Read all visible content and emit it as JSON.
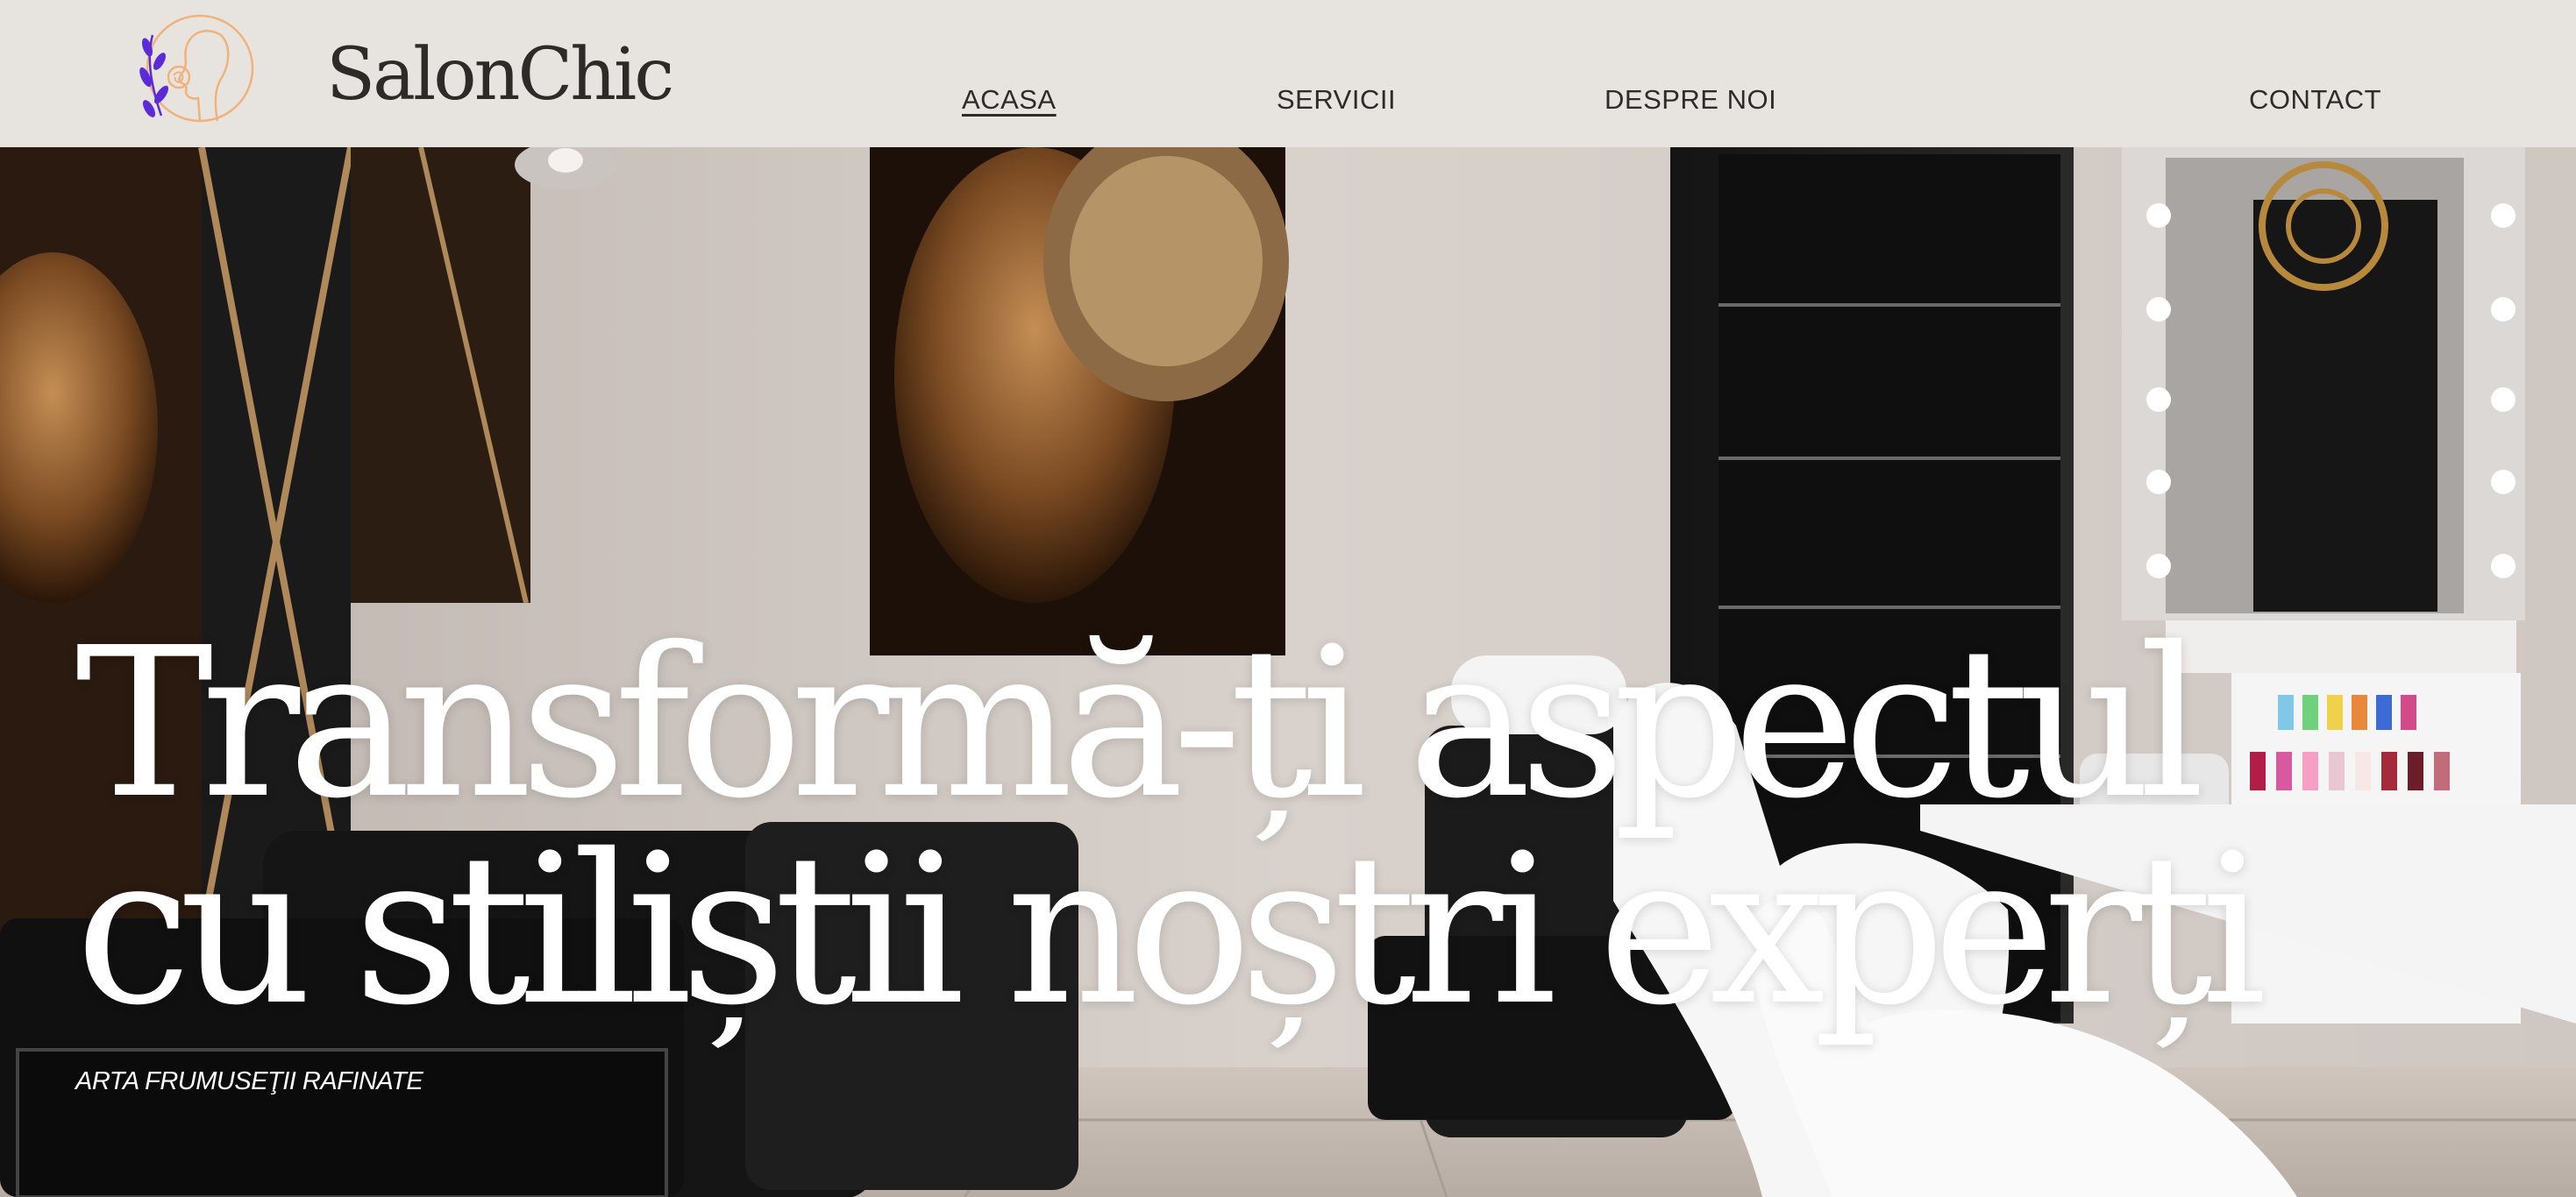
{
  "brand": {
    "name": "SalonChic",
    "logo_icon": "woman-profile-rose-logo"
  },
  "nav": {
    "items": [
      {
        "label": "ACASA",
        "active": true
      },
      {
        "label": "SERVICII",
        "active": false
      },
      {
        "label": "DESPRE NOI",
        "active": false
      },
      {
        "label": "CONTACT",
        "active": false
      }
    ]
  },
  "hero": {
    "headline_line1": "Transformă-ți aspectul",
    "headline_line2": "cu stiliștii noștri experți",
    "tagline": "ARTA FRUMUSEŢII RAFINATE",
    "background_image": "salon-interior-photo"
  },
  "colors": {
    "header_bg": "#e7e4df",
    "text_dark": "#2d2a28",
    "logo_orange": "#f0b27a",
    "logo_purple": "#5b2bd8",
    "hero_text": "#ffffff"
  }
}
